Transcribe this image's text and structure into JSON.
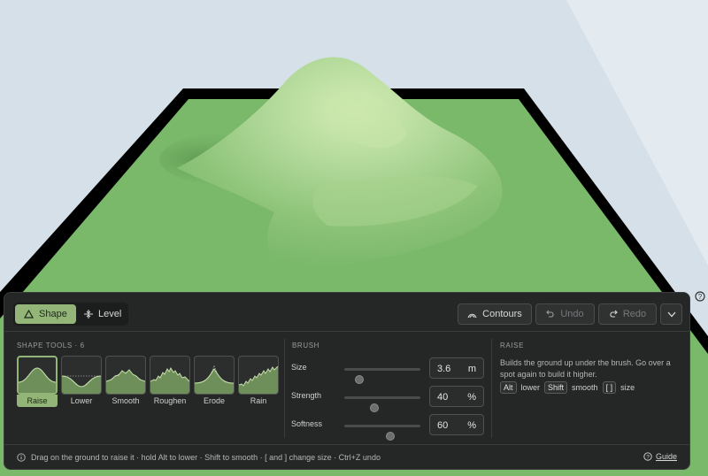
{
  "colors": {
    "sky": "#d6e0e8",
    "ground": "#7ab86a",
    "hill_light": "#d4ecb4",
    "base_border": "#000000",
    "panel_bg": "#252626",
    "accent": "#93b678"
  },
  "mode_switch": {
    "shape_label": "Shape",
    "level_label": "Level",
    "active": "Shape"
  },
  "toolbar": {
    "contours_label": "Contours",
    "undo_label": "Undo",
    "redo_label": "Redo"
  },
  "shape_tools": {
    "title": "SHAPE TOOLS · 6",
    "selected": "Raise",
    "items": [
      {
        "label": "Raise",
        "icon": "raise-profile-icon"
      },
      {
        "label": "Lower",
        "icon": "lower-profile-icon"
      },
      {
        "label": "Smooth",
        "icon": "smooth-profile-icon"
      },
      {
        "label": "Roughen",
        "icon": "roughen-profile-icon"
      },
      {
        "label": "Erode",
        "icon": "erode-profile-icon"
      },
      {
        "label": "Rain",
        "icon": "rain-profile-icon"
      }
    ]
  },
  "brush": {
    "title": "BRUSH",
    "size": {
      "label": "Size",
      "value": "3.6",
      "unit": "m",
      "slider_fraction": 0.2
    },
    "strength": {
      "label": "Strength",
      "value": "40",
      "unit": "%",
      "slider_fraction": 0.4
    },
    "softness": {
      "label": "Softness",
      "value": "60",
      "unit": "%",
      "slider_fraction": 0.6
    }
  },
  "raise_info": {
    "title": "RAISE",
    "description": "Builds the ground up under the brush. Go over a spot again to build it higher.",
    "keys": [
      {
        "key": "Alt",
        "action": "lower"
      },
      {
        "key": "Shift",
        "action": "smooth"
      },
      {
        "key": "[ ]",
        "action": "size"
      }
    ]
  },
  "footer": {
    "hint": "Drag on the ground to raise it · hold Alt to lower · Shift to smooth · [ and ] change size · Ctrl+Z undo",
    "guide_label": "Guide"
  }
}
